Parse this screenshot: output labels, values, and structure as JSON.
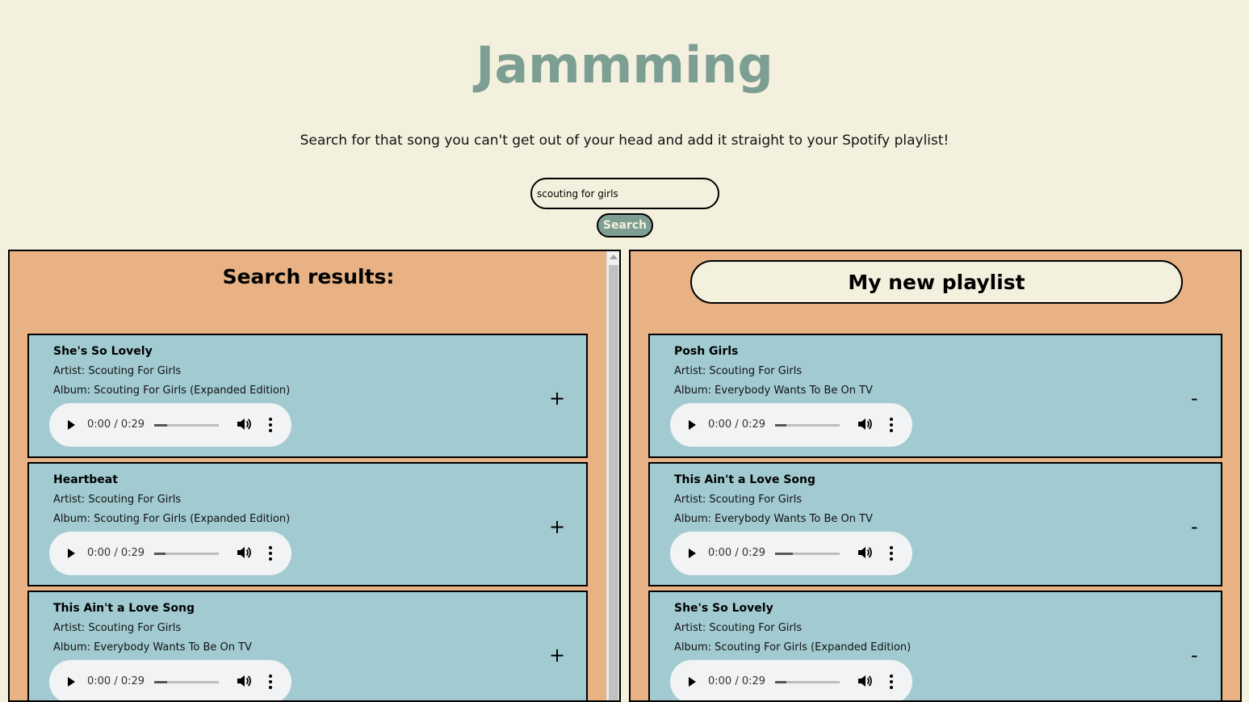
{
  "app": {
    "title": "Jammming",
    "subtitle": "Search for that song you can't get out of your head and add it straight to your Spotify playlist!"
  },
  "search": {
    "value": "scouting for girls",
    "button_label": "Search"
  },
  "results": {
    "heading": "Search results:",
    "action_symbol": "+",
    "tracks": [
      {
        "name": "She's So Lovely",
        "artist": "Artist: Scouting For Girls",
        "album": "Album: Scouting For Girls (Expanded Edition)",
        "time": "0:00 / 0:29",
        "progress": 0.2
      },
      {
        "name": "Heartbeat",
        "artist": "Artist: Scouting For Girls",
        "album": "Album: Scouting For Girls (Expanded Edition)",
        "time": "0:00 / 0:29",
        "progress": 0.17
      },
      {
        "name": "This Ain't a Love Song",
        "artist": "Artist: Scouting For Girls",
        "album": "Album: Everybody Wants To Be On TV",
        "time": "0:00 / 0:29",
        "progress": 0.2
      }
    ]
  },
  "playlist": {
    "name": "My new playlist",
    "action_symbol": "-",
    "tracks": [
      {
        "name": "Posh Girls",
        "artist": "Artist: Scouting For Girls",
        "album": "Album: Everybody Wants To Be On TV",
        "time": "0:00 / 0:29",
        "progress": 0.17
      },
      {
        "name": "This Ain't a Love Song",
        "artist": "Artist: Scouting For Girls",
        "album": "Album: Everybody Wants To Be On TV",
        "time": "0:00 / 0:29",
        "progress": 0.27
      },
      {
        "name": "She's So Lovely",
        "artist": "Artist: Scouting For Girls",
        "album": "Album: Scouting For Girls (Expanded Edition)",
        "time": "0:00 / 0:29",
        "progress": 0.17
      }
    ]
  },
  "icons": {
    "play": "play-icon",
    "volume": "volume-icon",
    "more": "more-options-icon"
  },
  "colors": {
    "background": "#f4f0de",
    "title": "#7d9e92",
    "panel": "#e8b285",
    "track": "#a2cbd1",
    "player": "#f1f3f4"
  }
}
